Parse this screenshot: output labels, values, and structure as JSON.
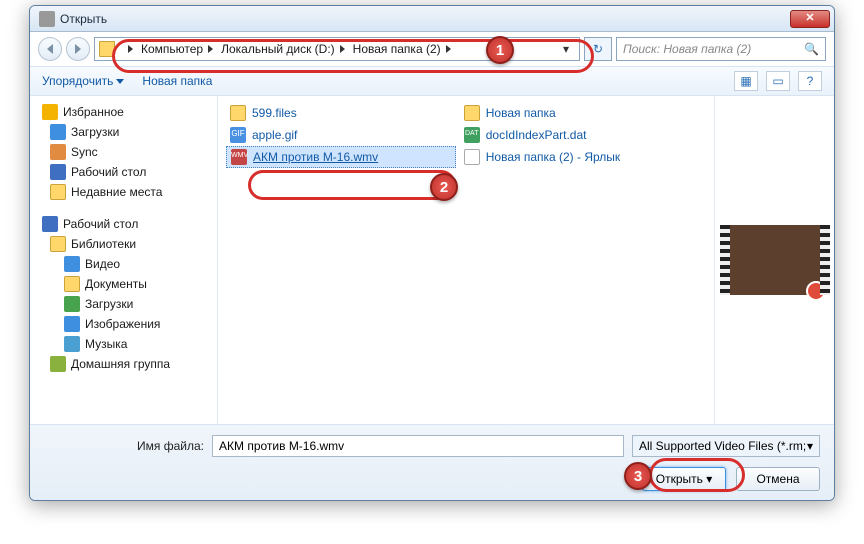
{
  "title": "Открыть",
  "close": "✕",
  "nav_triangle": "▾",
  "refresh_glyph": "↻",
  "search_placeholder": "Поиск: Новая папка (2)",
  "search_glyph": "🔍",
  "breadcrumbs": [
    "Компьютер",
    "Локальный диск (D:)",
    "Новая папка (2)"
  ],
  "toolbar": {
    "organize": "Упорядочить",
    "newfolder": "Новая папка",
    "view_glyph": "▦",
    "preview_glyph": "▭",
    "help_glyph": "?"
  },
  "tree": {
    "fav": "Избранное",
    "downloads": "Загрузки",
    "sync": "Sync",
    "desktop": "Рабочий стол",
    "recent": "Недавние места",
    "desktop2": "Рабочий стол",
    "libs": "Библиотеки",
    "video": "Видео",
    "docs": "Документы",
    "downloads2": "Загрузки",
    "images": "Изображения",
    "music": "Музыка",
    "homegroup": "Домашняя группа"
  },
  "files_left": [
    {
      "icon": "fi-folder",
      "name": "599.files"
    },
    {
      "icon": "fi-gif",
      "label": "GIF",
      "name": "apple.gif"
    },
    {
      "icon": "fi-wmv",
      "label": "WMV",
      "name": "АКМ против М-16.wmv",
      "selected": true
    }
  ],
  "files_right": [
    {
      "icon": "fi-folder",
      "name": "Новая папка"
    },
    {
      "icon": "fi-dat",
      "label": "DAT",
      "name": "docIdIndexPart.dat"
    },
    {
      "icon": "fi-lnk",
      "name": "Новая папка (2) - Ярлык"
    }
  ],
  "footer": {
    "label": "Имя файла:",
    "value": "АКМ против М-16.wmv",
    "filter": "All Supported Video Files (*.rm;",
    "open": "Открыть",
    "cancel": "Отмена",
    "dd": "▾"
  },
  "badges": {
    "1": "1",
    "2": "2",
    "3": "3"
  }
}
